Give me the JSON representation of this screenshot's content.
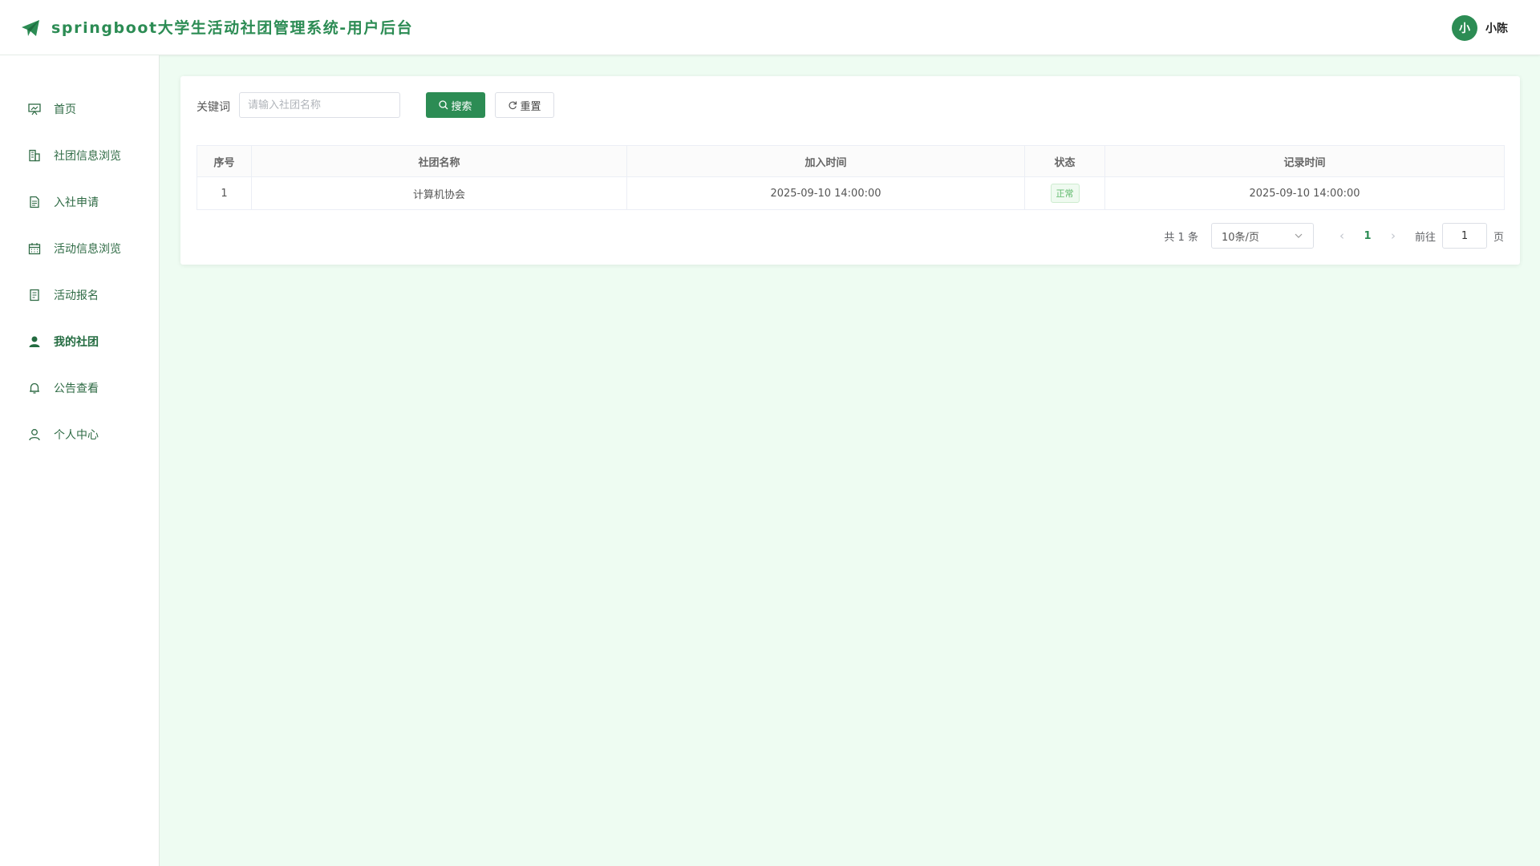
{
  "header": {
    "title": "springboot大学生活动社团管理系统-用户后台",
    "avatar_letter": "小",
    "username": "小陈"
  },
  "sidebar": {
    "items": [
      {
        "label": "首页",
        "icon": "presentation-icon",
        "active": false
      },
      {
        "label": "社团信息浏览",
        "icon": "building-icon",
        "active": false
      },
      {
        "label": "入社申请",
        "icon": "document-icon",
        "active": false
      },
      {
        "label": "活动信息浏览",
        "icon": "calendar-icon",
        "active": false
      },
      {
        "label": "活动报名",
        "icon": "form-icon",
        "active": false
      },
      {
        "label": "我的社团",
        "icon": "user-filled-icon",
        "active": true
      },
      {
        "label": "公告查看",
        "icon": "bell-icon",
        "active": false
      },
      {
        "label": "个人中心",
        "icon": "user-icon",
        "active": false
      }
    ]
  },
  "search": {
    "label": "关键词",
    "placeholder": "请输入社团名称",
    "value": "",
    "search_button": "搜索",
    "reset_button": "重置"
  },
  "table": {
    "columns": [
      "序号",
      "社团名称",
      "加入时间",
      "状态",
      "记录时间"
    ],
    "rows": [
      {
        "index": "1",
        "club_name": "计算机协会",
        "join_time": "2025-09-10 14:00:00",
        "status": "正常",
        "record_time": "2025-09-10 14:00:00"
      }
    ]
  },
  "pagination": {
    "total": "共 1 条",
    "page_size": "10条/页",
    "current_page": "1",
    "goto_label": "前往",
    "goto_value": "1",
    "page_suffix": "页"
  },
  "colors": {
    "primary": "#2c8c54",
    "background": "#eefcf2",
    "status_text": "#5fb96b"
  }
}
